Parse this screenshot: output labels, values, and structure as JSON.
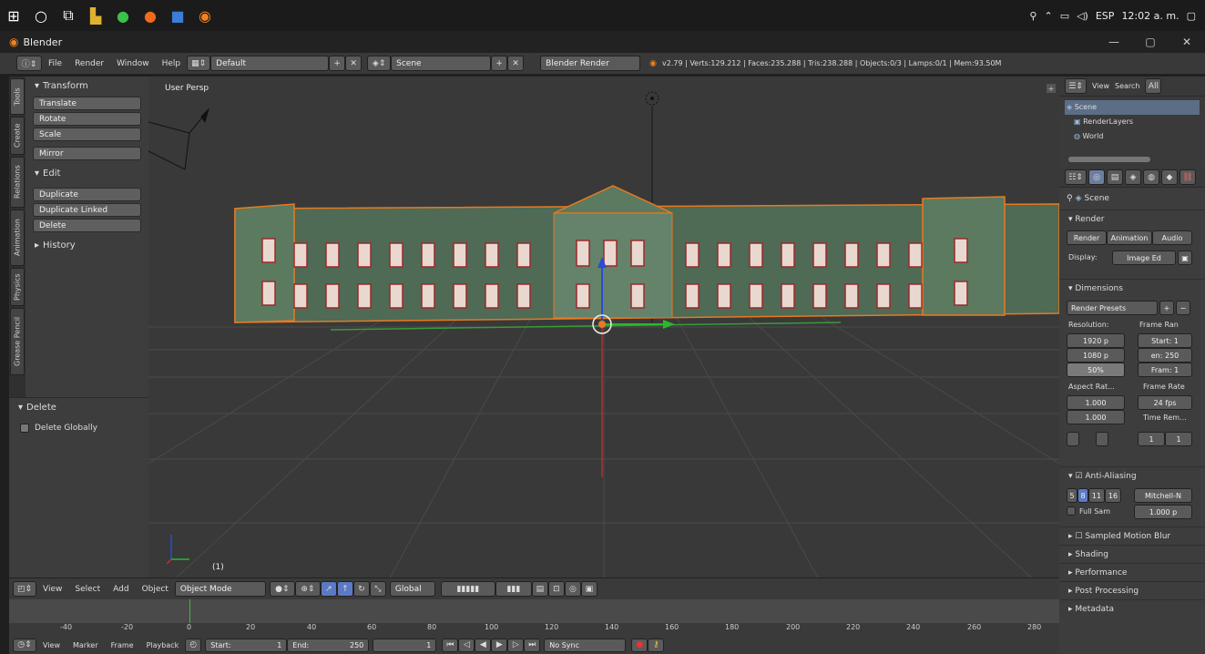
{
  "window": {
    "title": "Blender",
    "min_icon": "minimize-icon",
    "max_icon": "maximize-icon",
    "close_icon": "close-icon"
  },
  "taskbar": {
    "lang": "ESP",
    "time": "12:02 a. m."
  },
  "info": {
    "menus": [
      "File",
      "Render",
      "Window",
      "Help"
    ],
    "layout": "Default",
    "scene": "Scene",
    "engine": "Blender Render",
    "stats": "v2.79 | Verts:129.212 | Faces:235.288 | Tris:238.288 | Objects:0/3 | Lamps:0/1 | Mem:93.50M"
  },
  "toolshelf": {
    "vtabs": [
      "Tools",
      "Create",
      "Relations",
      "Animation",
      "Physics",
      "Grease Pencil"
    ],
    "transform_title": "Transform",
    "transform": [
      "Translate",
      "Rotate",
      "Scale"
    ],
    "mirror": "Mirror",
    "edit_title": "Edit",
    "edit": [
      "Duplicate",
      "Duplicate Linked",
      "Delete"
    ],
    "history_title": "History",
    "delete_title": "Delete",
    "delete_globally": "Delete Globally"
  },
  "viewport": {
    "label": "User Persp",
    "obj": "(1)"
  },
  "outliner": {
    "view": "View",
    "search": "Search",
    "all": "All",
    "items": [
      "Scene",
      "RenderLayers",
      "World"
    ]
  },
  "props": {
    "scene": "Scene",
    "render": "Render",
    "btns": [
      "Render",
      "Animation",
      "Audio"
    ],
    "display_label": "Display:",
    "display_value": "Image Ed",
    "dimensions": "Dimensions",
    "presets": "Render Presets",
    "res_label": "Resolution:",
    "frame_label": "Frame Ran",
    "res_x": "1920 p",
    "res_y": "1080 p",
    "res_pct": "50%",
    "start": "Start: 1",
    "end": "en: 250",
    "step": "Fram: 1",
    "aspect_label": "Aspect Rat...",
    "rate_label": "Frame Rate",
    "asp_x": "1.000",
    "asp_y": "1.000",
    "fps": "24 fps",
    "time_label": "Time Rem...",
    "time_a": "1",
    "time_b": "1",
    "aa": "Anti-Aliasing",
    "aa_values": [
      "5",
      "8",
      "11",
      "16"
    ],
    "filter": "Mitchell-N",
    "full_sample": "Full Sam",
    "px": "1.000 p",
    "sampled": "Sampled Motion Blur",
    "sections": [
      "Shading",
      "Performance",
      "Post Processing",
      "Metadata"
    ]
  },
  "vpheader": {
    "view": "View",
    "select": "Select",
    "add": "Add",
    "object": "Object",
    "mode": "Object Mode",
    "orient": "Global"
  },
  "timeline": {
    "ticks": [
      "-40",
      "-20",
      "0",
      "20",
      "40",
      "60",
      "80",
      "100",
      "120",
      "140",
      "160",
      "180",
      "200",
      "220",
      "240",
      "260",
      "280"
    ]
  },
  "tlheader": {
    "view": "View",
    "marker": "Marker",
    "frame": "Frame",
    "playback": "Playback",
    "start": "Start:",
    "start_val": "1",
    "end": "End:",
    "end_val": "250",
    "cur": "1",
    "sync": "No Sync"
  }
}
